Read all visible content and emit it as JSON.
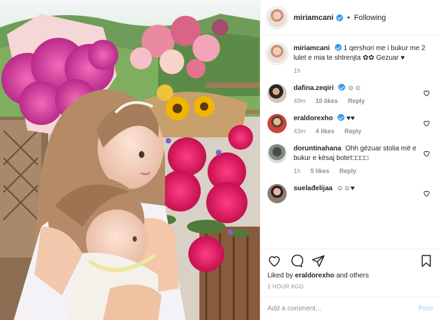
{
  "post": {
    "username": "miriamcani",
    "follow_status": "Following",
    "caption": "1 qershori me i bukur me 2 lulet e mia te shtrenjta ✿✿ Gezuar ♥",
    "caption_time": "1h"
  },
  "comments": [
    {
      "username": "dafina.zeqiri",
      "verified": true,
      "text": "☺☺",
      "time": "49m",
      "likes": "10 likes",
      "reply": "Reply"
    },
    {
      "username": "eraldorexho",
      "verified": true,
      "text": "♥♥",
      "time": "43m",
      "likes": "4 likes",
      "reply": "Reply"
    },
    {
      "username": "doruntinahana",
      "verified": false,
      "text": "Ohh gëzuar stolia më e bukur e kësaj bote!□□□□",
      "time": "1h",
      "likes": "5 likes",
      "reply": "Reply"
    },
    {
      "username": "suelađelijaa",
      "verified": false,
      "text": "☺☺♥",
      "time": "",
      "likes": "",
      "reply": ""
    }
  ],
  "liked_by": {
    "prefix": "Liked by",
    "user": "eraldorexho",
    "suffix": "and others"
  },
  "time_ago": "1 HOUR AGO",
  "add_comment": {
    "placeholder": "Add a comment...",
    "post_label": "Post"
  },
  "icons": [
    "heart-icon",
    "comment-icon",
    "share-icon",
    "bookmark-icon",
    "verified-icon"
  ],
  "colors": {
    "link_blue": "#3897f0",
    "post_disabled": "#b2dffc",
    "muted": "#8e8e8e",
    "text": "#262626"
  }
}
